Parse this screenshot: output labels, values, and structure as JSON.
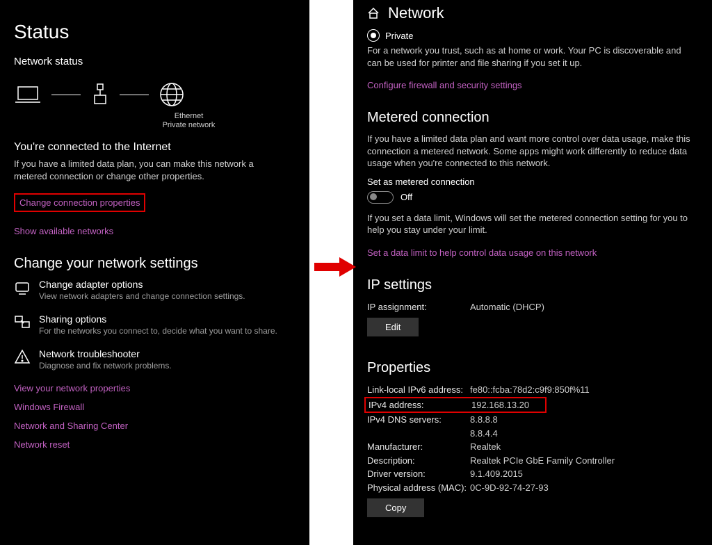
{
  "left": {
    "title": "Status",
    "subtitle": "Network status",
    "diagram": {
      "label1": "Ethernet",
      "label2": "Private network"
    },
    "connected_heading": "You're connected to the Internet",
    "connected_desc": "If you have a limited data plan, you can make this network a metered connection or change other properties.",
    "change_props_link": "Change connection properties",
    "show_networks_link": "Show available networks",
    "change_settings_heading": "Change your network settings",
    "items": [
      {
        "title": "Change adapter options",
        "desc": "View network adapters and change connection settings."
      },
      {
        "title": "Sharing options",
        "desc": "For the networks you connect to, decide what you want to share."
      },
      {
        "title": "Network troubleshooter",
        "desc": "Diagnose and fix network problems."
      }
    ],
    "links": [
      "View your network properties",
      "Windows Firewall",
      "Network and Sharing Center",
      "Network reset"
    ]
  },
  "right": {
    "header": "Network",
    "private_label": "Private",
    "private_desc": "For a network you trust, such as at home or work. Your PC is discoverable and can be used for printer and file sharing if you set it up.",
    "firewall_link": "Configure firewall and security settings",
    "metered_heading": "Metered connection",
    "metered_desc": "If you have a limited data plan and want more control over data usage, make this connection a metered network. Some apps might work differently to reduce data usage when you're connected to this network.",
    "metered_toggle_label": "Set as metered connection",
    "metered_toggle_state": "Off",
    "metered_limit_desc": "If you set a data limit, Windows will set the metered connection setting for you to help you stay under your limit.",
    "metered_limit_link": "Set a data limit to help control data usage on this network",
    "ip_heading": "IP settings",
    "ip_assign_key": "IP assignment:",
    "ip_assign_val": "Automatic (DHCP)",
    "edit_btn": "Edit",
    "props_heading": "Properties",
    "props": {
      "ipv6_key": "Link-local IPv6 address:",
      "ipv6_val": "fe80::fcba:78d2:c9f9:850f%11",
      "ipv4_key": "IPv4 address:",
      "ipv4_val": "192.168.13.20",
      "dns_key": "IPv4 DNS servers:",
      "dns_val1": "8.8.8.8",
      "dns_val2": "8.8.4.4",
      "mfr_key": "Manufacturer:",
      "mfr_val": "Realtek",
      "desc_key": "Description:",
      "desc_val": "Realtek PCIe GbE Family Controller",
      "drv_key": "Driver version:",
      "drv_val": "9.1.409.2015",
      "mac_key": "Physical address (MAC):",
      "mac_val": "0C-9D-92-74-27-93"
    },
    "copy_btn": "Copy"
  }
}
